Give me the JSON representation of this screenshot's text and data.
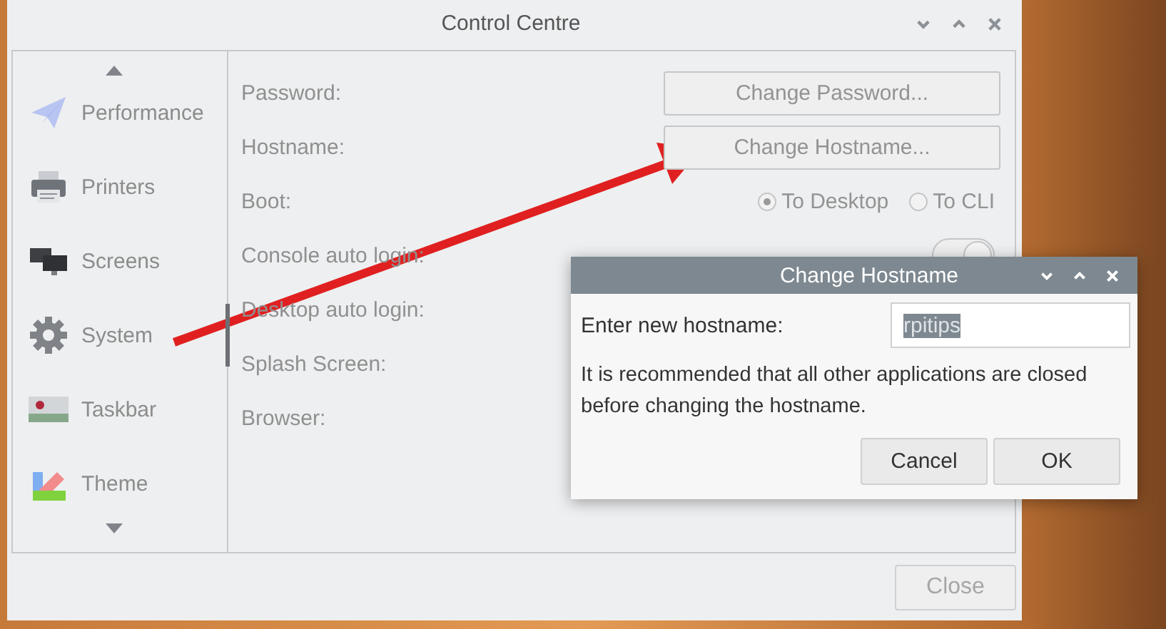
{
  "window": {
    "title": "Control Centre"
  },
  "sidebar": {
    "items": [
      {
        "label": "Performance",
        "kind": "performance",
        "selected": false
      },
      {
        "label": "Printers",
        "kind": "printer",
        "selected": false
      },
      {
        "label": "Screens",
        "kind": "screens",
        "selected": false
      },
      {
        "label": "System",
        "kind": "system",
        "selected": true
      },
      {
        "label": "Taskbar",
        "kind": "taskbar",
        "selected": false
      },
      {
        "label": "Theme",
        "kind": "theme",
        "selected": false
      }
    ]
  },
  "settings": {
    "rows": [
      {
        "label": "Password:",
        "kind": "button",
        "button": "Change Password..."
      },
      {
        "label": "Hostname:",
        "kind": "button",
        "button": "Change Hostname..."
      },
      {
        "label": "Boot:",
        "kind": "radio",
        "options": [
          {
            "label": "To Desktop",
            "selected": true
          },
          {
            "label": "To CLI",
            "selected": false
          }
        ]
      },
      {
        "label": "Console auto login:",
        "kind": "switch",
        "on": true
      },
      {
        "label": "Desktop auto login:",
        "kind": "label"
      },
      {
        "label": "Splash Screen:",
        "kind": "label"
      },
      {
        "label": "Browser:",
        "kind": "label"
      }
    ]
  },
  "footer": {
    "close": "Close"
  },
  "dialog": {
    "title": "Change Hostname",
    "field_label": "Enter new hostname:",
    "value": "rpitips",
    "value_selected": true,
    "message": "It is recommended that all other applications are closed before changing the hostname.",
    "buttons": [
      "Cancel",
      "OK"
    ]
  }
}
